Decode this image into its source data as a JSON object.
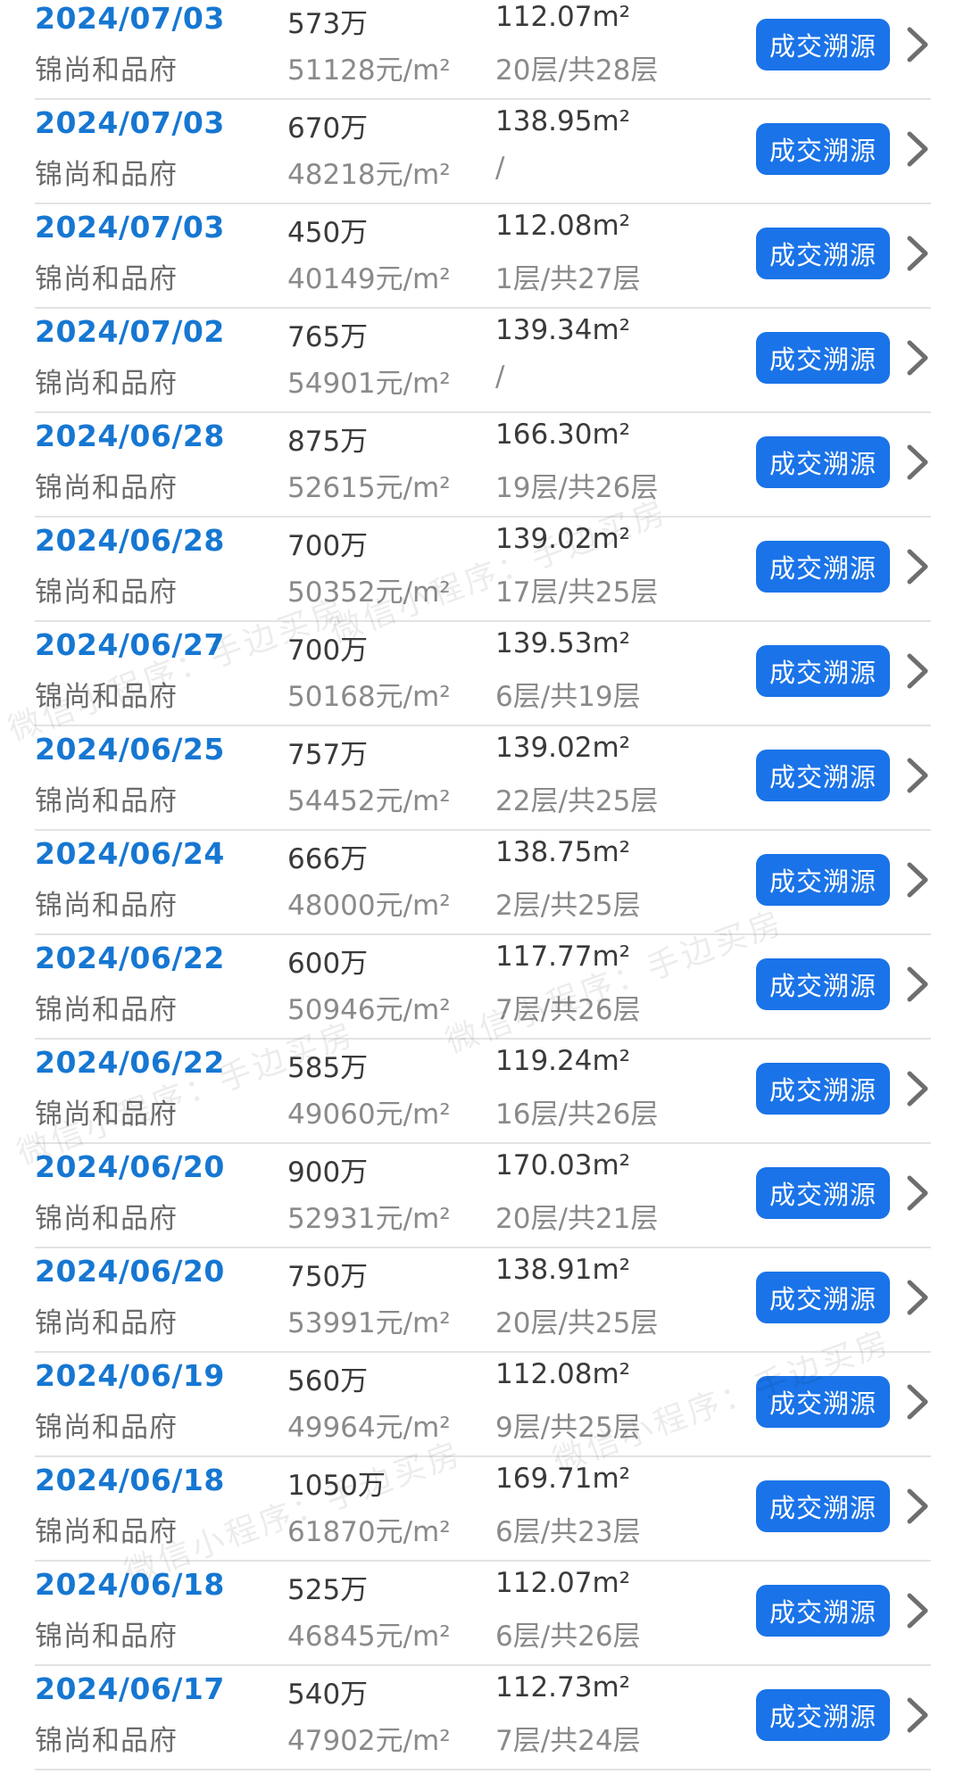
{
  "list": {
    "button_label": "成交溯源",
    "rows": [
      {
        "date": "2024/07/03",
        "name": "锦尚和品府",
        "price": "573万",
        "unit_price": "51128元/m²",
        "area": "112.07m²",
        "floor": "20层/共28层"
      },
      {
        "date": "2024/07/03",
        "name": "锦尚和品府",
        "price": "670万",
        "unit_price": "48218元/m²",
        "area": "138.95m²",
        "floor": "/"
      },
      {
        "date": "2024/07/03",
        "name": "锦尚和品府",
        "price": "450万",
        "unit_price": "40149元/m²",
        "area": "112.08m²",
        "floor": "1层/共27层"
      },
      {
        "date": "2024/07/02",
        "name": "锦尚和品府",
        "price": "765万",
        "unit_price": "54901元/m²",
        "area": "139.34m²",
        "floor": "/"
      },
      {
        "date": "2024/06/28",
        "name": "锦尚和品府",
        "price": "875万",
        "unit_price": "52615元/m²",
        "area": "166.30m²",
        "floor": "19层/共26层"
      },
      {
        "date": "2024/06/28",
        "name": "锦尚和品府",
        "price": "700万",
        "unit_price": "50352元/m²",
        "area": "139.02m²",
        "floor": "17层/共25层"
      },
      {
        "date": "2024/06/27",
        "name": "锦尚和品府",
        "price": "700万",
        "unit_price": "50168元/m²",
        "area": "139.53m²",
        "floor": "6层/共19层"
      },
      {
        "date": "2024/06/25",
        "name": "锦尚和品府",
        "price": "757万",
        "unit_price": "54452元/m²",
        "area": "139.02m²",
        "floor": "22层/共25层"
      },
      {
        "date": "2024/06/24",
        "name": "锦尚和品府",
        "price": "666万",
        "unit_price": "48000元/m²",
        "area": "138.75m²",
        "floor": "2层/共25层"
      },
      {
        "date": "2024/06/22",
        "name": "锦尚和品府",
        "price": "600万",
        "unit_price": "50946元/m²",
        "area": "117.77m²",
        "floor": "7层/共26层"
      },
      {
        "date": "2024/06/22",
        "name": "锦尚和品府",
        "price": "585万",
        "unit_price": "49060元/m²",
        "area": "119.24m²",
        "floor": "16层/共26层"
      },
      {
        "date": "2024/06/20",
        "name": "锦尚和品府",
        "price": "900万",
        "unit_price": "52931元/m²",
        "area": "170.03m²",
        "floor": "20层/共21层"
      },
      {
        "date": "2024/06/20",
        "name": "锦尚和品府",
        "price": "750万",
        "unit_price": "53991元/m²",
        "area": "138.91m²",
        "floor": "20层/共25层"
      },
      {
        "date": "2024/06/19",
        "name": "锦尚和品府",
        "price": "560万",
        "unit_price": "49964元/m²",
        "area": "112.08m²",
        "floor": "9层/共25层"
      },
      {
        "date": "2024/06/18",
        "name": "锦尚和品府",
        "price": "1050万",
        "unit_price": "61870元/m²",
        "area": "169.71m²",
        "floor": "6层/共23层"
      },
      {
        "date": "2024/06/18",
        "name": "锦尚和品府",
        "price": "525万",
        "unit_price": "46845元/m²",
        "area": "112.07m²",
        "floor": "6层/共26层"
      },
      {
        "date": "2024/06/17",
        "name": "锦尚和品府",
        "price": "540万",
        "unit_price": "47902元/m²",
        "area": "112.73m²",
        "floor": "7层/共24层"
      }
    ]
  },
  "watermark": {
    "text": "微信小程序：手边买房"
  },
  "colors": {
    "date": "#1677d2",
    "button": "#1a73e8",
    "divider": "#e3e3e3"
  }
}
